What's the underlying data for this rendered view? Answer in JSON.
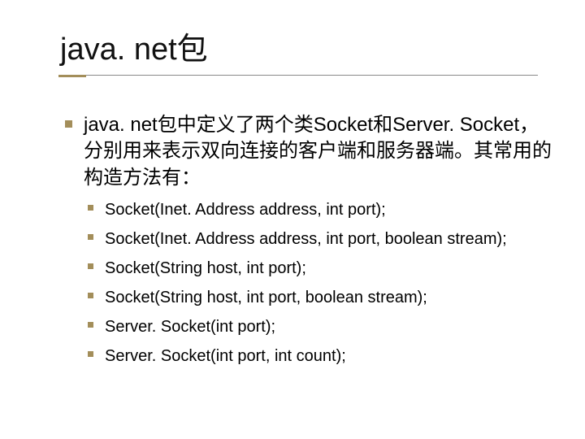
{
  "title": "java. net包",
  "level1": "java. net包中定义了两个类Socket和Server. Socket，分别用来表示双向连接的客户端和服务器端。其常用的构造方法有：",
  "level2": [
    "Socket(Inet. Address address, int port);",
    "Socket(Inet. Address address, int  port, boolean stream);",
    "Socket(String host, int port);",
    "Socket(String host, int port, boolean stream);",
    "Server. Socket(int port);",
    "Server. Socket(int port, int count);"
  ]
}
